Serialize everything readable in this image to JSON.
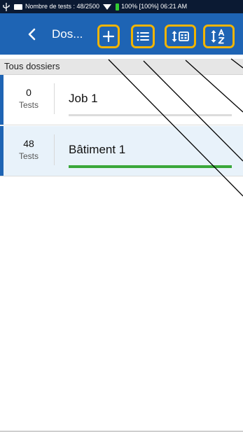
{
  "status_bar": {
    "tests_count": "Nombre de tests : 48/2500",
    "battery": "100% [100%] 06:21 AM"
  },
  "header": {
    "title": "Dos...",
    "buttons": [
      "add-icon",
      "list-icon",
      "expand-collapse-icon",
      "sort-az-icon"
    ]
  },
  "section": {
    "label": "Tous dossiers"
  },
  "folders": [
    {
      "count": "0",
      "unit": "Tests",
      "name": "Job 1",
      "progress": 0
    },
    {
      "count": "48",
      "unit": "Tests",
      "name": "Bâtiment 1",
      "progress": 1.0
    }
  ],
  "colors": {
    "header": "#1e64b4",
    "status_bar": "#0b1a33",
    "highlight_outline": "#f0b400",
    "selected_row": "#e8f2fa",
    "progress": "#3aa83a"
  }
}
